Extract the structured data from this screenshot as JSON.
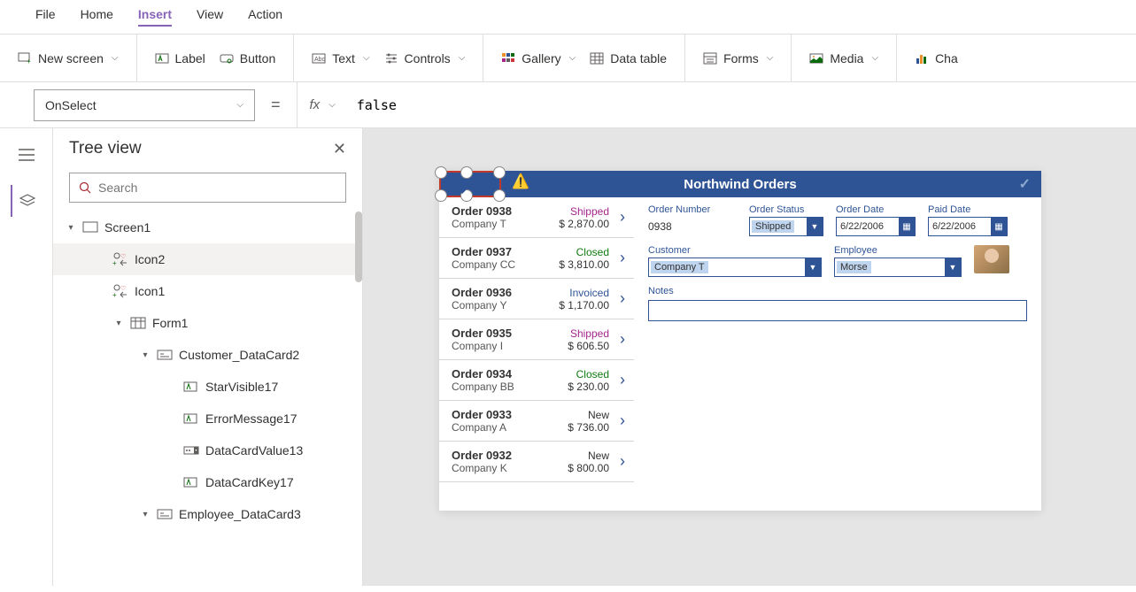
{
  "menubar": [
    "File",
    "Home",
    "Insert",
    "View",
    "Action"
  ],
  "menubar_active": 2,
  "ribbon": {
    "new_screen": "New screen",
    "label": "Label",
    "button": "Button",
    "text": "Text",
    "controls": "Controls",
    "gallery": "Gallery",
    "datatable": "Data table",
    "forms": "Forms",
    "media": "Media",
    "chart": "Cha"
  },
  "formula": {
    "property": "OnSelect",
    "equals": "=",
    "fx": "fx",
    "value": "false"
  },
  "tree": {
    "title": "Tree view",
    "search_placeholder": "Search",
    "nodes": [
      {
        "indent": 0,
        "caret": "▾",
        "icon": "screen",
        "label": "Screen1",
        "selected": false
      },
      {
        "indent": 1,
        "caret": "",
        "icon": "icon2",
        "label": "Icon2",
        "selected": true
      },
      {
        "indent": 1,
        "caret": "",
        "icon": "icon2",
        "label": "Icon1",
        "selected": false
      },
      {
        "indent": 2,
        "caret": "▾",
        "icon": "form",
        "label": "Form1",
        "selected": false
      },
      {
        "indent": 3,
        "caret": "▾",
        "icon": "card",
        "label": "Customer_DataCard2",
        "selected": false
      },
      {
        "indent": 4,
        "caret": "",
        "icon": "pencil",
        "label": "StarVisible17",
        "selected": false
      },
      {
        "indent": 4,
        "caret": "",
        "icon": "pencil",
        "label": "ErrorMessage17",
        "selected": false
      },
      {
        "indent": 4,
        "caret": "",
        "icon": "dropdown",
        "label": "DataCardValue13",
        "selected": false
      },
      {
        "indent": 4,
        "caret": "",
        "icon": "pencil",
        "label": "DataCardKey17",
        "selected": false
      },
      {
        "indent": 3,
        "caret": "▾",
        "icon": "card",
        "label": "Employee_DataCard3",
        "selected": false
      }
    ]
  },
  "app": {
    "title": "Northwind Orders",
    "gallery": [
      {
        "order": "Order 0938",
        "company": "Company T",
        "status": "Shipped",
        "amount": "$ 2,870.00"
      },
      {
        "order": "Order 0937",
        "company": "Company CC",
        "status": "Closed",
        "amount": "$ 3,810.00"
      },
      {
        "order": "Order 0936",
        "company": "Company Y",
        "status": "Invoiced",
        "amount": "$ 1,170.00"
      },
      {
        "order": "Order 0935",
        "company": "Company I",
        "status": "Shipped",
        "amount": "$ 606.50"
      },
      {
        "order": "Order 0934",
        "company": "Company BB",
        "status": "Closed",
        "amount": "$ 230.00"
      },
      {
        "order": "Order 0933",
        "company": "Company A",
        "status": "New",
        "amount": "$ 736.00"
      },
      {
        "order": "Order 0932",
        "company": "Company K",
        "status": "New",
        "amount": "$ 800.00"
      }
    ],
    "detail": {
      "order_number_label": "Order Number",
      "order_number": "0938",
      "order_status_label": "Order Status",
      "order_status": "Shipped",
      "order_date_label": "Order Date",
      "order_date": "6/22/2006",
      "paid_date_label": "Paid Date",
      "paid_date": "6/22/2006",
      "customer_label": "Customer",
      "customer": "Company T",
      "employee_label": "Employee",
      "employee": "Morse",
      "notes_label": "Notes"
    }
  }
}
